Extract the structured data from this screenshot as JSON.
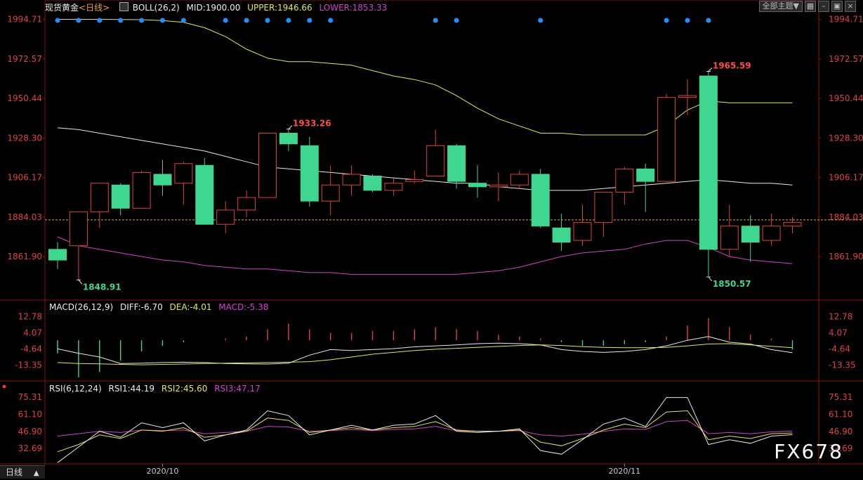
{
  "header": {
    "instrument": "现货黄金",
    "period_tag": "<日线>",
    "boll": {
      "label": "BOLL(26,2)",
      "mid": "MID:1900.00",
      "upper": "UPPER:1946.66",
      "lower": "LOWER:1853.33"
    }
  },
  "toolbar": {
    "theme_label": "全部主题",
    "theme_arrow": "▼"
  },
  "macd_header": {
    "label": "MACD(26,12,9)",
    "diff": "DIFF:-6.70",
    "dea": "DEA:-4.01",
    "macd": "MACD:-5.38"
  },
  "rsi_header": {
    "label": "RSI(6,12,24)",
    "rsi1": "RSI1:44.19",
    "rsi2": "RSI2:45.60",
    "rsi3": "RSI3:47.17"
  },
  "period_tab": {
    "label": "日线",
    "arrow": "▲"
  },
  "watermark": "FX678",
  "colors": {
    "up": "#e04040",
    "down": "#3fd68f",
    "upper": "#e6e64a",
    "mid": "#e8e8e8",
    "lower": "#d040d0",
    "dots": "#1e90ff",
    "grid": "#8a1010"
  },
  "chart_data": [
    {
      "type": "candlestick",
      "title": "现货黄金 日线",
      "price_ticks": [
        "1994.71",
        "1972.57",
        "1950.44",
        "1928.30",
        "1906.17",
        "1884.03",
        "1861.90"
      ],
      "ylim": [
        1838,
        2000
      ],
      "current_price": 1882.5,
      "x_labels": [
        {
          "index": 5,
          "label": "2020/10"
        },
        {
          "index": 27,
          "label": "2020/11"
        }
      ],
      "annotations": [
        {
          "index": 1,
          "value": 1848.91,
          "text": "1848.91",
          "pos": "below",
          "color": "down"
        },
        {
          "index": 11,
          "value": 1933.26,
          "text": "1933.26",
          "pos": "above",
          "color": "up"
        },
        {
          "index": 31,
          "value": 1965.59,
          "text": "1965.59",
          "pos": "above",
          "color": "up"
        },
        {
          "index": 31,
          "value": 1850.57,
          "text": "1850.57",
          "pos": "below",
          "color": "down"
        }
      ],
      "ohlc": [
        [
          1866,
          1870,
          1855,
          1860
        ],
        [
          1868,
          1886,
          1849,
          1887
        ],
        [
          1887,
          1903,
          1878,
          1903
        ],
        [
          1902,
          1903,
          1885,
          1889
        ],
        [
          1889,
          1910,
          1889,
          1909
        ],
        [
          1908,
          1916,
          1896,
          1902
        ],
        [
          1903,
          1915,
          1891,
          1914
        ],
        [
          1913,
          1917,
          1880,
          1880
        ],
        [
          1880,
          1893,
          1875,
          1888
        ],
        [
          1888,
          1899,
          1884,
          1895
        ],
        [
          1895,
          1931,
          1895,
          1931
        ],
        [
          1931,
          1933,
          1921,
          1925
        ],
        [
          1924,
          1929,
          1890,
          1893
        ],
        [
          1893,
          1913,
          1885,
          1902
        ],
        [
          1902,
          1913,
          1896,
          1908
        ],
        [
          1907,
          1908,
          1898,
          1899
        ],
        [
          1899,
          1906,
          1896,
          1903
        ],
        [
          1904,
          1910,
          1903,
          1905
        ],
        [
          1907,
          1933,
          1907,
          1924
        ],
        [
          1924,
          1925,
          1900,
          1904
        ],
        [
          1903,
          1913,
          1895,
          1901
        ],
        [
          1901,
          1909,
          1893,
          1902
        ],
        [
          1902,
          1910,
          1900,
          1908
        ],
        [
          1908,
          1911,
          1878,
          1879
        ],
        [
          1878,
          1886,
          1865,
          1870
        ],
        [
          1871,
          1891,
          1868,
          1881
        ],
        [
          1881,
          1897,
          1873,
          1898
        ],
        [
          1898,
          1912,
          1891,
          1911
        ],
        [
          1911,
          1914,
          1887,
          1904
        ],
        [
          1904,
          1953,
          1904,
          1951
        ],
        [
          1951,
          1961,
          1941,
          1952
        ],
        [
          1963,
          1966,
          1851,
          1866
        ],
        [
          1866,
          1891,
          1862,
          1879
        ],
        [
          1879,
          1885,
          1859,
          1870
        ],
        [
          1871,
          1886,
          1868,
          1879
        ],
        [
          1879,
          1884,
          1875,
          1881
        ]
      ],
      "boll_upper": [
        1994.7,
        1994.7,
        1994.7,
        1994.6,
        1994.5,
        1994,
        1993,
        1990,
        1985,
        1978,
        1973,
        1971,
        1971,
        1970,
        1969,
        1966,
        1963,
        1961,
        1958,
        1952,
        1945,
        1939,
        1935,
        1931,
        1931,
        1930,
        1930,
        1930,
        1930,
        1935,
        1944,
        1949,
        1948,
        1948,
        1948,
        1948
      ],
      "boll_mid": [
        1934,
        1933,
        1931,
        1929,
        1927,
        1925,
        1923,
        1921,
        1918,
        1915,
        1912,
        1911,
        1910,
        1909,
        1908,
        1907,
        1906,
        1905,
        1904,
        1903,
        1903,
        1901,
        1900,
        1899,
        1899,
        1899,
        1900,
        1901,
        1902,
        1903,
        1904,
        1905,
        1904,
        1903,
        1903,
        1902
      ],
      "boll_lower": [
        1873,
        1868,
        1866,
        1864,
        1862,
        1860,
        1859,
        1857,
        1856,
        1855,
        1855,
        1854,
        1853,
        1853,
        1852,
        1852,
        1852,
        1852,
        1852,
        1852,
        1853,
        1854,
        1856,
        1859,
        1862,
        1864,
        1865,
        1866,
        1869,
        1871,
        1871,
        1867,
        1862,
        1860,
        1859,
        1858
      ],
      "top_dot_indices": [
        0,
        1,
        2,
        3,
        4,
        5,
        6,
        8,
        9,
        10,
        11,
        12,
        13,
        18,
        19,
        23,
        29,
        30,
        31
      ]
    },
    {
      "type": "bar+line",
      "title": "MACD(26,12,9)",
      "y_ticks": [
        "12.78",
        "4.07",
        "-4.64",
        "-13.35"
      ],
      "ylim": [
        -20,
        16
      ],
      "macd_hist": [
        -7,
        -20,
        -17,
        -11,
        -6,
        -3,
        -1,
        0,
        1,
        2,
        6,
        9,
        6,
        4,
        4,
        5,
        5,
        6,
        7,
        6,
        5,
        3,
        2,
        1,
        -1,
        -3,
        -3,
        -2,
        -1,
        2,
        8,
        12,
        7,
        3,
        1,
        -5
      ],
      "dif": [
        -4.6,
        -7,
        -9,
        -12.5,
        -12.3,
        -12,
        -11.8,
        -12,
        -12.5,
        -12.7,
        -12.8,
        -12.4,
        -8,
        -5,
        -5.5,
        -5,
        -4.5,
        -3.5,
        -3,
        -2.5,
        -1.8,
        -1.5,
        -1.8,
        -2.5,
        -5,
        -6,
        -6.5,
        -6,
        -5,
        -3,
        0,
        2,
        -1,
        -2,
        -5,
        -6.7
      ],
      "dea": [
        -12,
        -12.5,
        -12.7,
        -13,
        -13.2,
        -13,
        -12.8,
        -12.5,
        -12.3,
        -12.2,
        -12,
        -11.8,
        -11.5,
        -10.5,
        -9,
        -7.5,
        -6.5,
        -5.5,
        -4.8,
        -4.3,
        -3.8,
        -3.3,
        -2.8,
        -2.5,
        -2.8,
        -3.4,
        -3.8,
        -4,
        -4,
        -3.8,
        -3,
        -2,
        -1.8,
        -2.5,
        -3.2,
        -4.01
      ]
    },
    {
      "type": "line",
      "title": "RSI(6,12,24)",
      "y_ticks": [
        "75.31",
        "61.10",
        "46.90",
        "32.69"
      ],
      "ylim": [
        20,
        80
      ],
      "rsi1": [
        21,
        34,
        47,
        42,
        54,
        50,
        54,
        39,
        44,
        48,
        64,
        60,
        44,
        48,
        52,
        48,
        52,
        53,
        60,
        47,
        46,
        47,
        49,
        31,
        28,
        40,
        53,
        58,
        51,
        75,
        75,
        36,
        40,
        37,
        43,
        44.19
      ],
      "rsi2": [
        30,
        36,
        44,
        41,
        48,
        47,
        50,
        42,
        44,
        47,
        58,
        56,
        46,
        48,
        50,
        48,
        50,
        51,
        55,
        48,
        47,
        47,
        48,
        38,
        35,
        41,
        48,
        53,
        50,
        63,
        64,
        40,
        43,
        41,
        45,
        45.6
      ],
      "rsi3": [
        43,
        45,
        47,
        46,
        48,
        47.5,
        48,
        45,
        46,
        47,
        51,
        50.5,
        47,
        47.5,
        48.5,
        47.5,
        48.5,
        49,
        51,
        47.5,
        47,
        47,
        47.5,
        44,
        43,
        44.5,
        47,
        49,
        48.5,
        55,
        56,
        45,
        46,
        45,
        46.5,
        47.17
      ]
    }
  ]
}
